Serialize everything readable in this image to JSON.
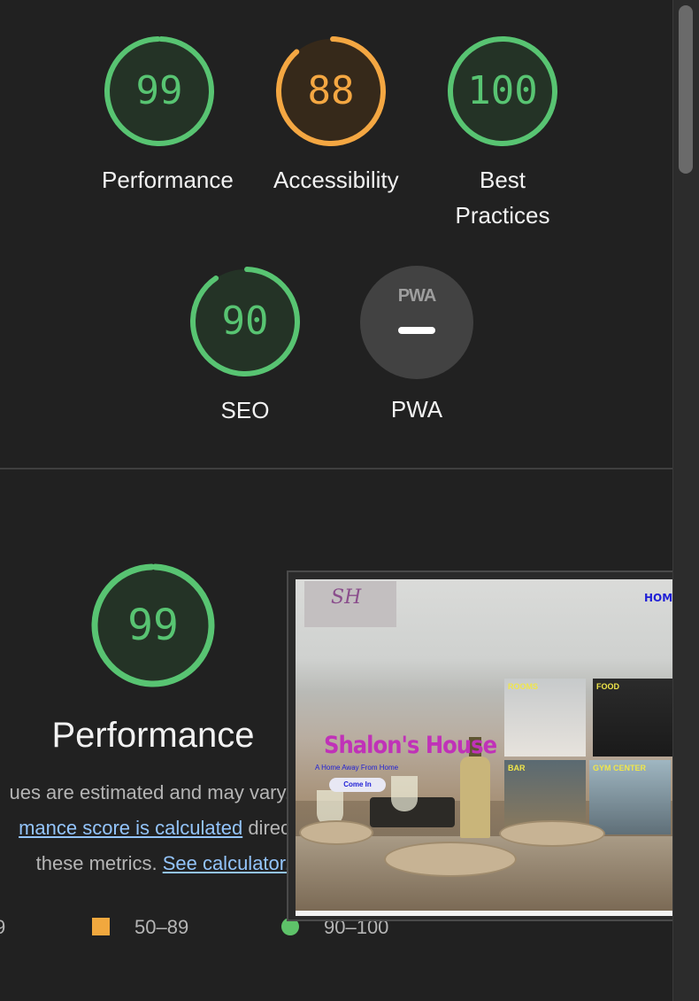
{
  "colors": {
    "good": "#58c472",
    "average": "#f4a742",
    "ring_bg_good": "#243326",
    "ring_bg_avg": "#36291a"
  },
  "gauges": [
    {
      "score": 99,
      "label": "Performance",
      "status": "good",
      "fraction": 0.99
    },
    {
      "score": 88,
      "label": "Accessibility",
      "status": "average",
      "fraction": 0.88
    },
    {
      "score": 100,
      "label": "Best Practices",
      "status": "good",
      "fraction": 1.0
    },
    {
      "score": 90,
      "label": "SEO",
      "status": "good",
      "fraction": 0.9
    }
  ],
  "pwa": {
    "logo_text": "PWA",
    "label": "PWA",
    "icon": "dash-icon"
  },
  "performance": {
    "score": 99,
    "fraction": 0.99,
    "title": "Performance",
    "desc_line1": "ues are estimated and may vary.",
    "desc_link1": "mance score is calculated",
    "desc_line2_rest": " direc",
    "desc_line3_text": "these metrics. ",
    "desc_link2": "See calculator."
  },
  "legend": {
    "range_fail": "9",
    "range_avg": "50–89",
    "range_pass": "90–100"
  },
  "screenshot": {
    "logo": "SH",
    "nav_home": "HOME",
    "title": "Shalon's House",
    "subtitle": "A Home Away From Home",
    "button": "Come In",
    "tiles": [
      "ROOMS",
      "FOOD",
      "BAR",
      "GYM CENTER"
    ]
  }
}
